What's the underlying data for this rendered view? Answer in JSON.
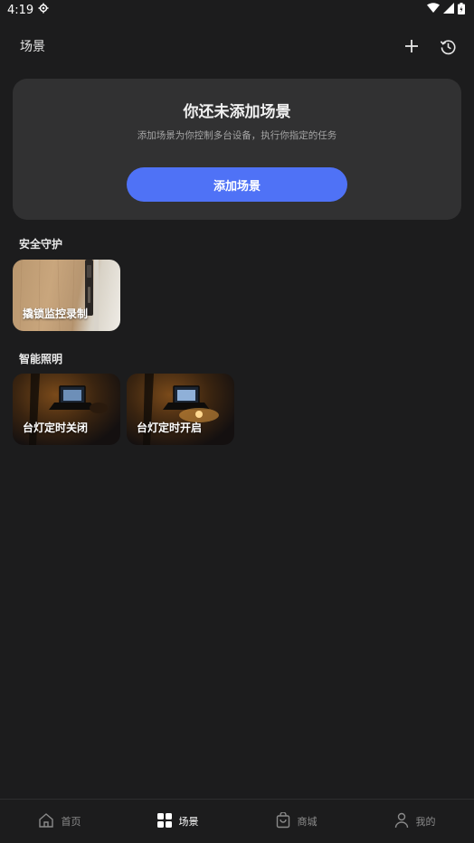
{
  "status_bar": {
    "time": "4:19"
  },
  "header": {
    "title": "场景"
  },
  "empty_state": {
    "title": "你还未添加场景",
    "subtitle": "添加场景为你控制多台设备，执行你指定的任务",
    "button_label": "添加场景"
  },
  "sections": [
    {
      "title": "安全守护",
      "tiles": [
        {
          "label": "撬锁监控录制"
        }
      ]
    },
    {
      "title": "智能照明",
      "tiles": [
        {
          "label": "台灯定时关闭"
        },
        {
          "label": "台灯定时开启"
        }
      ]
    }
  ],
  "bottom_nav": [
    {
      "label": "首页",
      "icon": "home-icon",
      "active": false
    },
    {
      "label": "场景",
      "icon": "grid-icon",
      "active": true
    },
    {
      "label": "商城",
      "icon": "shopping-bag-icon",
      "active": false
    },
    {
      "label": "我的",
      "icon": "person-icon",
      "active": false
    }
  ],
  "colors": {
    "accent": "#4f72f6",
    "background": "#1c1c1d",
    "card": "#313132"
  }
}
